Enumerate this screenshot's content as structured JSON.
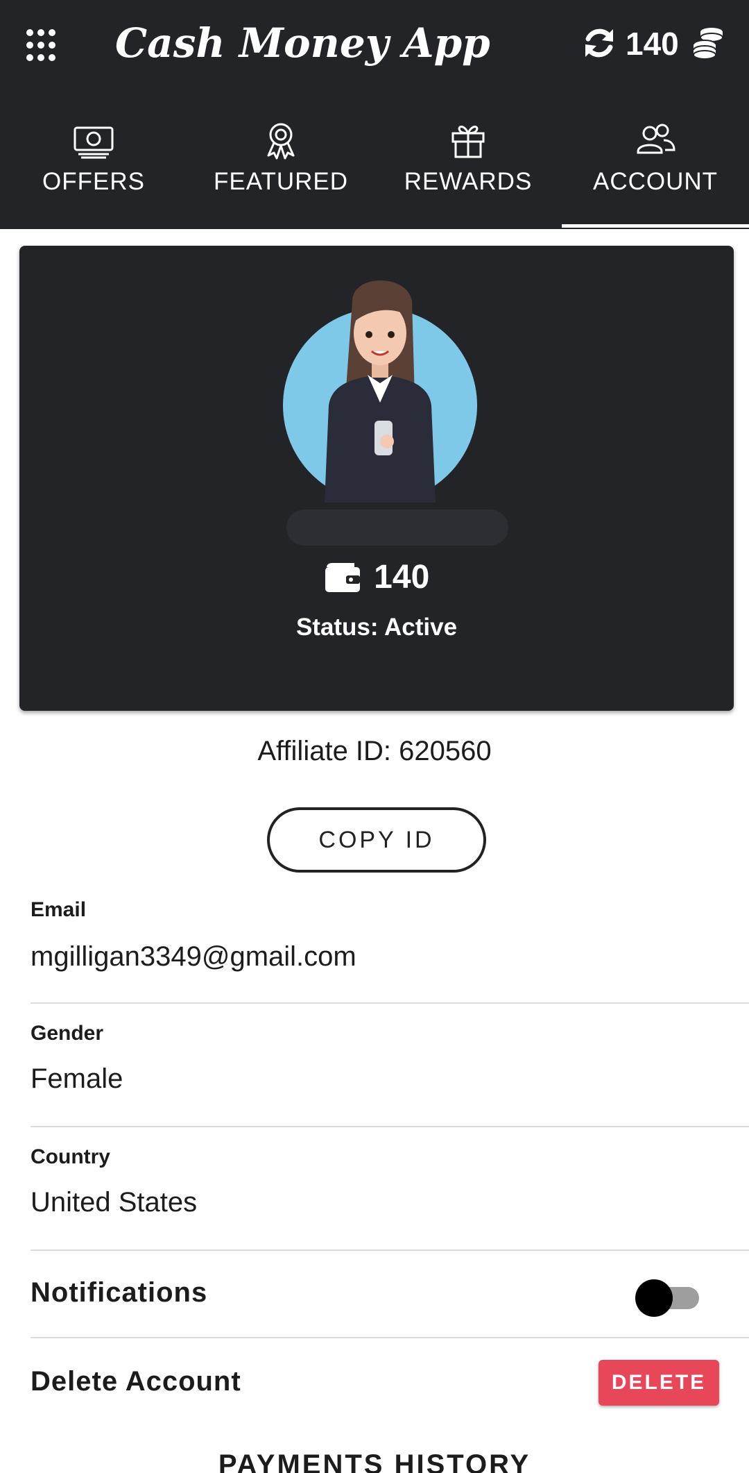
{
  "header": {
    "app_title": "Cash Money App",
    "coin_count": "140",
    "menu_icon": "grid-menu-icon",
    "refresh_icon": "refresh-icon",
    "coins_icon": "coins-stack-icon"
  },
  "tabs": [
    {
      "label": "OFFERS",
      "icon": "money-bill-icon",
      "active": false
    },
    {
      "label": "FEATURED",
      "icon": "award-ribbon-icon",
      "active": false
    },
    {
      "label": "REWARDS",
      "icon": "gift-icon",
      "active": false
    },
    {
      "label": "ACCOUNT",
      "icon": "users-icon",
      "active": true
    }
  ],
  "profile": {
    "balance": "140",
    "status": "Status: Active",
    "wallet_icon": "wallet-icon"
  },
  "affiliate": {
    "text": "Affiliate ID: 620560",
    "copy_label": "COPY ID"
  },
  "fields": {
    "email": {
      "label": "Email",
      "value": "mgilligan3349@gmail.com"
    },
    "gender": {
      "label": "Gender",
      "value": "Female"
    },
    "country": {
      "label": "Country",
      "value": "United States"
    }
  },
  "notifications": {
    "label": "Notifications",
    "enabled": false
  },
  "delete_account": {
    "label": "Delete Account",
    "button": "DELETE"
  },
  "payments": {
    "title": "PAYMENTS HISTORY"
  },
  "colors": {
    "header_bg": "#232428",
    "delete_red": "#e8475a",
    "avatar_circle": "#7ec8e8"
  }
}
